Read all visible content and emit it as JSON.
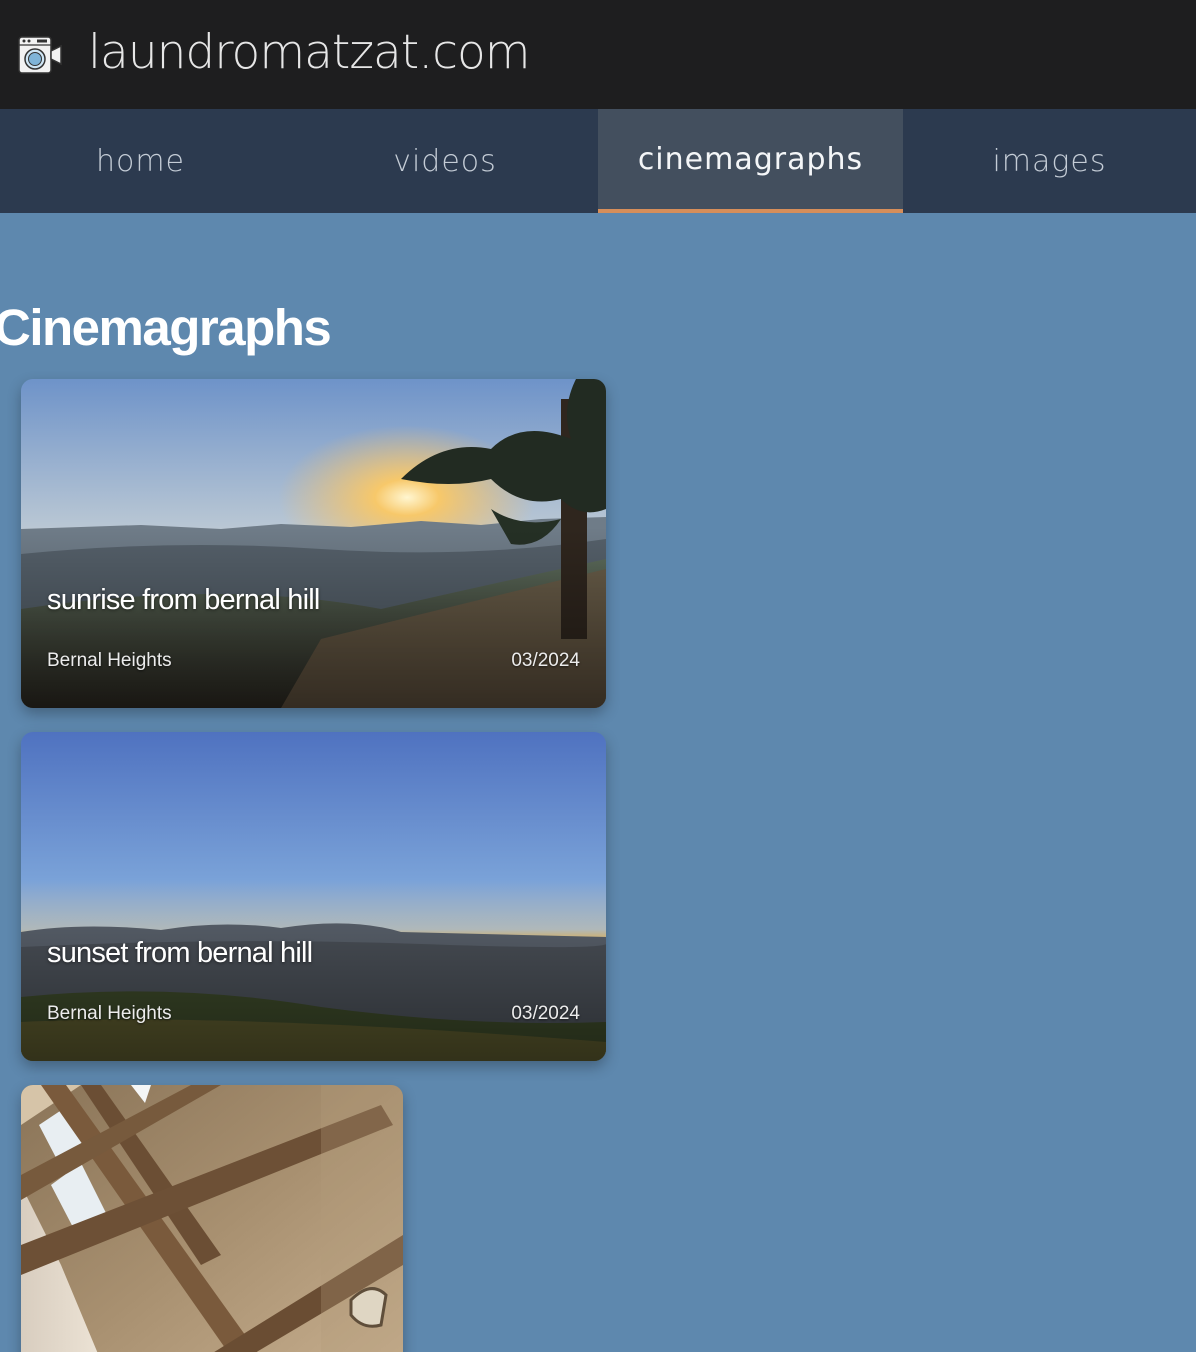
{
  "site": {
    "title": "laundromatzat.com",
    "logo_icon": "washing-machine-camera-icon"
  },
  "nav": {
    "tabs": [
      {
        "label": "home",
        "active": false
      },
      {
        "label": "videos",
        "active": false
      },
      {
        "label": "cinemagraphs",
        "active": true
      },
      {
        "label": "images",
        "active": false
      }
    ],
    "active_indicator_color": "#d68e5a"
  },
  "page": {
    "heading": "Cinemagraphs",
    "background_color": "#5e88ae"
  },
  "cards": [
    {
      "title": "sunrise from bernal hill",
      "location": "Bernal Heights",
      "date": "03/2024"
    },
    {
      "title": "sunset from bernal hill",
      "location": "Bernal Heights",
      "date": "03/2024"
    },
    {
      "title": "",
      "location": "",
      "date": ""
    }
  ]
}
